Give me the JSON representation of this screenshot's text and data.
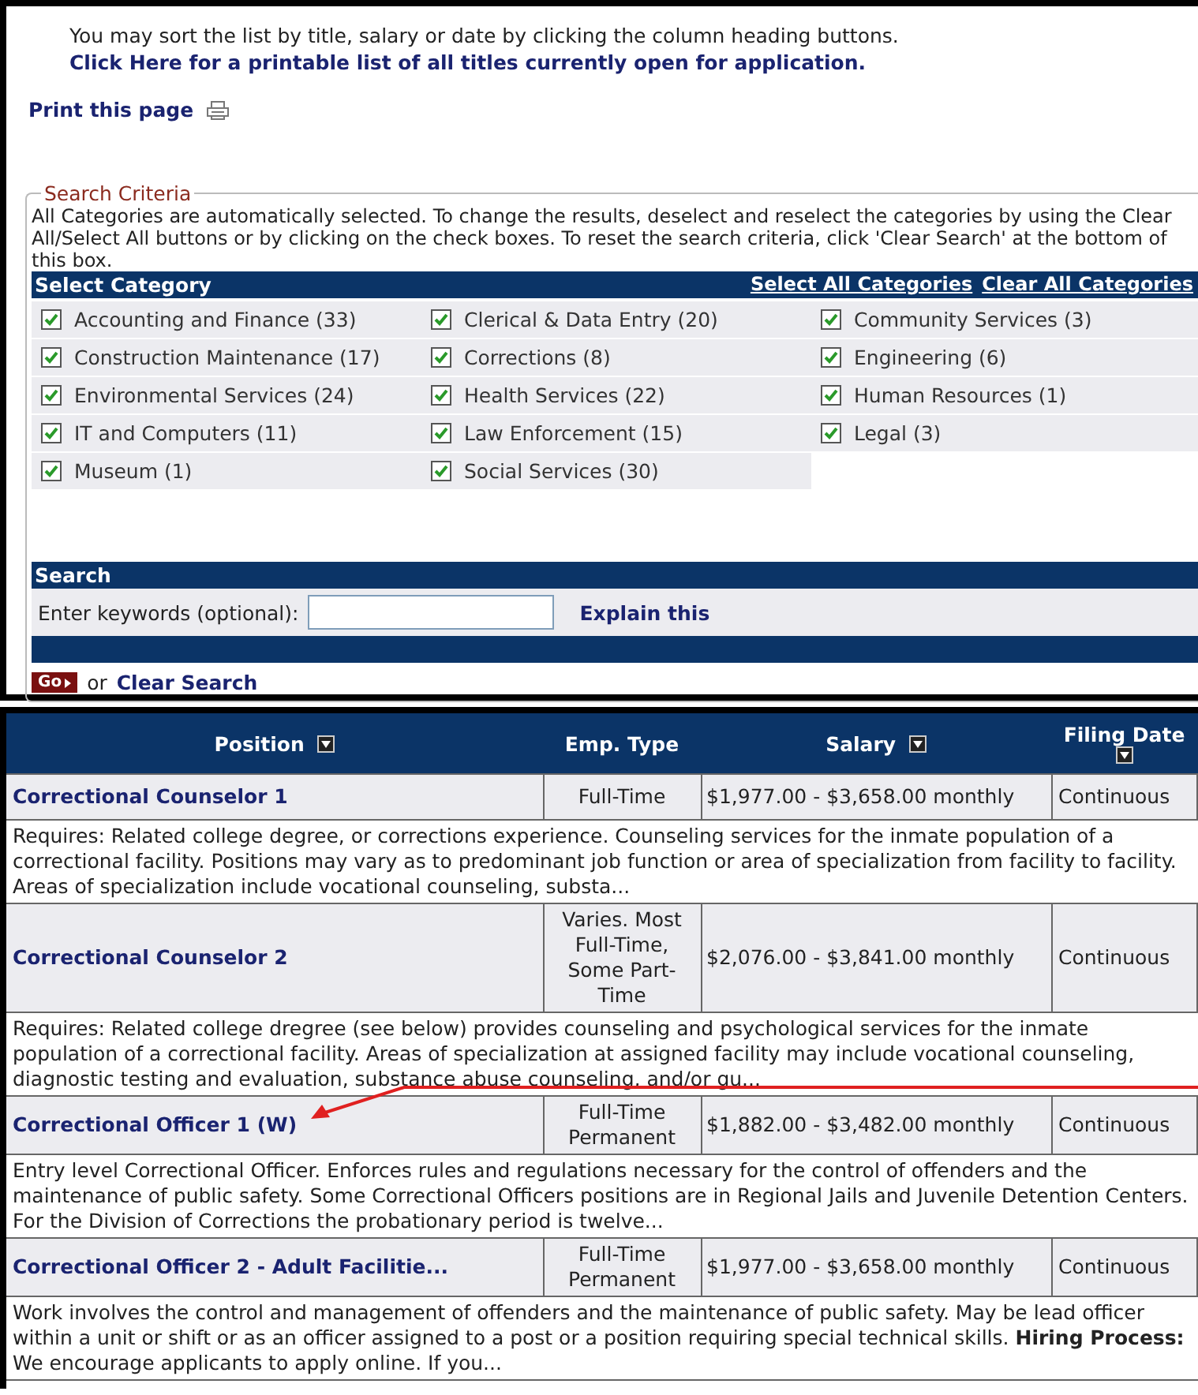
{
  "intro": {
    "text": "You may sort the list by title, salary or date by clicking the column heading buttons.",
    "link": "Click Here for a printable list of all titles currently open for application."
  },
  "print_link": "Print this page",
  "search_criteria": {
    "legend": "Search Criteria",
    "help": "All Categories are automatically selected. To change the results, deselect and reselect the categories by using the Clear All/Select All buttons or by clicking on the check boxes. To reset the search criteria, click 'Clear Search' at the bottom of this box.",
    "category_header": "Select Category",
    "select_all": "Select All Categories",
    "clear_all": "Clear All Categories",
    "categories": [
      {
        "label": "Accounting and Finance (33)",
        "checked": true
      },
      {
        "label": "Clerical & Data Entry (20)",
        "checked": true
      },
      {
        "label": "Community Services (3)",
        "checked": true
      },
      {
        "label": "Construction Maintenance (17)",
        "checked": true
      },
      {
        "label": "Corrections (8)",
        "checked": true
      },
      {
        "label": "Engineering (6)",
        "checked": true
      },
      {
        "label": "Environmental Services (24)",
        "checked": true
      },
      {
        "label": "Health Services (22)",
        "checked": true
      },
      {
        "label": "Human Resources (1)",
        "checked": true
      },
      {
        "label": "IT and Computers (11)",
        "checked": true
      },
      {
        "label": "Law Enforcement (15)",
        "checked": true
      },
      {
        "label": "Legal (3)",
        "checked": true
      },
      {
        "label": "Museum (1)",
        "checked": true
      },
      {
        "label": "Social Services (30)",
        "checked": true
      }
    ],
    "search_header": "Search",
    "keywords_label": "Enter keywords (optional):",
    "explain_link": "Explain this",
    "go_button": "Go",
    "or_text": "or",
    "clear_search": "Clear Search"
  },
  "table": {
    "columns": [
      {
        "label": "Position",
        "sortable": true
      },
      {
        "label": "Emp. Type",
        "sortable": false
      },
      {
        "label": "Salary",
        "sortable": true
      },
      {
        "label": "Filing Date",
        "sortable": true
      }
    ],
    "rows": [
      {
        "title": "Correctional Counselor 1",
        "emp_type": "Full-Time",
        "salary": "$1,977.00 - $3,658.00 monthly",
        "filing_date": "Continuous",
        "description": "Requires: Related college degree, or corrections experience. Counseling services for the inmate population of a correctional facility. Positions may vary as to predominant job function or area of specialization from facility to facility. Areas of specialization include vocational counseling, substa..."
      },
      {
        "title": "Correctional Counselor 2",
        "emp_type": "Varies. Most Full-Time, Some Part-Time",
        "salary": "$2,076.00 - $3,841.00 monthly",
        "filing_date": "Continuous",
        "description": "Requires: Related college dregree (see below) provides counseling and psychological services for the inmate population of a correctional facility. Areas of specialization at assigned facility may include vocational counseling, diagnostic testing and evaluation, substance abuse counseling, and/or gu..."
      },
      {
        "title": "Correctional Officer 1 (W)",
        "emp_type": "Full-Time Permanent",
        "salary": "$1,882.00 - $3,482.00 monthly",
        "filing_date": "Continuous",
        "description": "Entry level Correctional Officer. Enforces rules and regulations necessary for the control of offenders and the maintenance of public safety. Some Correctional Officers positions are in Regional Jails and Juvenile Detention Centers. For the Division of Corrections the probationary period is twelve..."
      },
      {
        "title": "Correctional Officer 2 - Adult Facilitie...",
        "emp_type": "Full-Time Permanent",
        "salary": "$1,977.00 - $3,658.00 monthly",
        "filing_date": "Continuous",
        "description": "Work involves the control and management of offenders and the maintenance of public safety. May be lead officer within a unit or shift or as an officer assigned to a post or a position requiring special technical skills. **Hiring Process:** We encourage applicants to apply online. If you..."
      }
    ]
  }
}
